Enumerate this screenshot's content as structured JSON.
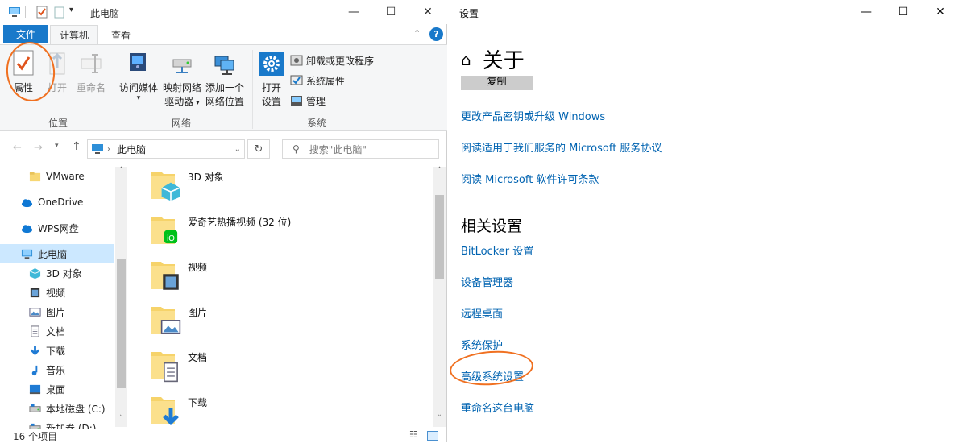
{
  "explorer": {
    "title": "此电脑",
    "tabs": {
      "file": "文件",
      "computer": "计算机",
      "view": "查看"
    },
    "ribbon": {
      "location": {
        "label": "位置",
        "properties": "属性",
        "open": "打开",
        "rename": "重命名"
      },
      "network": {
        "label": "网络",
        "access_media": "访问媒体",
        "map_drive_line1": "映射网络",
        "map_drive_line2": "驱动器",
        "add_location_line1": "添加一个",
        "add_location_line2": "网络位置"
      },
      "system": {
        "label": "系统",
        "open_settings_line1": "打开",
        "open_settings_line2": "设置",
        "uninstall": "卸载或更改程序",
        "system_props": "系统属性",
        "manage": "管理"
      }
    },
    "address": "此电脑",
    "search_placeholder": "搜索\"此电脑\"",
    "sidebar": [
      {
        "label": "VMware",
        "icon": "folder-icon"
      },
      {
        "label": "OneDrive",
        "icon": "cloud-icon"
      },
      {
        "label": "WPS网盘",
        "icon": "cloud-icon"
      },
      {
        "label": "此电脑",
        "icon": "computer-icon"
      },
      {
        "label": "3D 对象",
        "icon": "cube-icon"
      },
      {
        "label": "视频",
        "icon": "video-icon"
      },
      {
        "label": "图片",
        "icon": "picture-icon"
      },
      {
        "label": "文档",
        "icon": "document-icon"
      },
      {
        "label": "下载",
        "icon": "download-icon"
      },
      {
        "label": "音乐",
        "icon": "music-icon"
      },
      {
        "label": "桌面",
        "icon": "desktop-icon"
      },
      {
        "label": "本地磁盘 (C:)",
        "icon": "drive-icon"
      },
      {
        "label": "新加卷 (D:)",
        "icon": "drive-icon"
      }
    ],
    "folders": [
      {
        "label": "3D 对象",
        "icon": "cube-icon"
      },
      {
        "label": "爱奇艺热播视频 (32 位)",
        "icon": "iqiyi-icon"
      },
      {
        "label": "视频",
        "icon": "video-icon"
      },
      {
        "label": "图片",
        "icon": "picture-icon"
      },
      {
        "label": "文档",
        "icon": "document-icon"
      },
      {
        "label": "下载",
        "icon": "download-icon"
      }
    ],
    "status": "16 个项目",
    "help": "?"
  },
  "settings": {
    "title": "设置",
    "header": "关于",
    "copy_button": "复制",
    "links": [
      "更改产品密钥或升级 Windows",
      "阅读适用于我们服务的 Microsoft 服务协议",
      "阅读 Microsoft 软件许可条款"
    ],
    "related_heading": "相关设置",
    "related_links": [
      "BitLocker 设置",
      "设备管理器",
      "远程桌面",
      "系统保护",
      "高级系统设置",
      "重命名这台电脑"
    ]
  },
  "colors": {
    "accent": "#1979ca",
    "link": "#0063b1",
    "annotation": "#f07020",
    "selected": "#cce8ff"
  }
}
